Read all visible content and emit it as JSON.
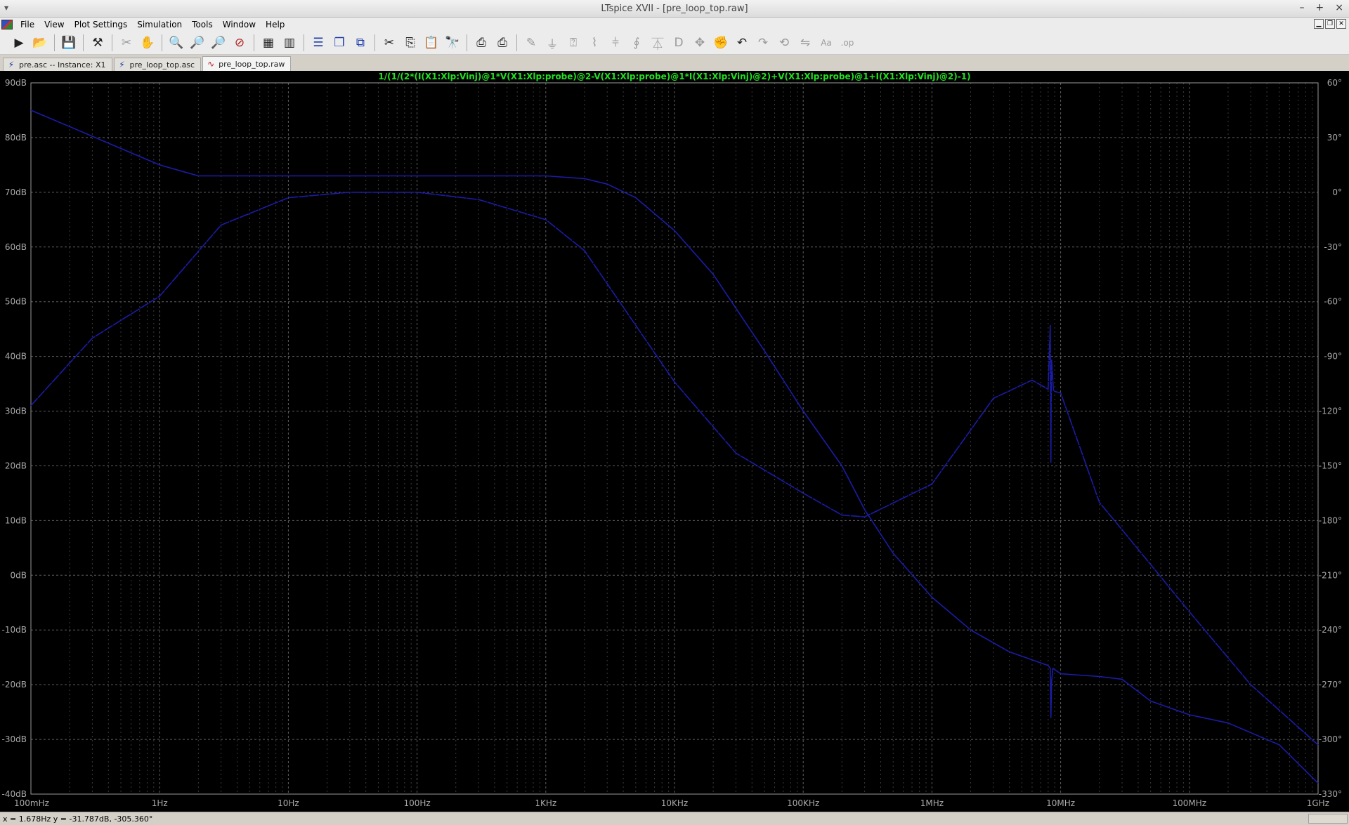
{
  "window": {
    "title": "LTspice XVII - [pre_loop_top.raw]",
    "sysmenu": "▾",
    "controls": [
      "–",
      "+",
      "×"
    ]
  },
  "menu": [
    "File",
    "View",
    "Plot Settings",
    "Simulation",
    "Tools",
    "Window",
    "Help"
  ],
  "mdi_controls": [
    "▁",
    "❐",
    "✕"
  ],
  "toolbar": [
    {
      "icon": "run-icon",
      "glyph": "▶"
    },
    {
      "icon": "open-icon",
      "glyph": "📂"
    },
    {
      "sep": true
    },
    {
      "icon": "save-icon",
      "glyph": "💾"
    },
    {
      "sep": true
    },
    {
      "icon": "control-panel-icon",
      "glyph": "⚒"
    },
    {
      "sep": true
    },
    {
      "icon": "halt-icon",
      "glyph": "✂",
      "dim": true
    },
    {
      "icon": "pan-icon",
      "glyph": "✋",
      "dim": true
    },
    {
      "sep": true
    },
    {
      "icon": "zoom-in-icon",
      "glyph": "🔍"
    },
    {
      "icon": "zoom-out-icon",
      "glyph": "🔎"
    },
    {
      "icon": "zoom-back-icon",
      "glyph": "🔎"
    },
    {
      "icon": "zoom-fit-icon",
      "glyph": "⊘",
      "red": true
    },
    {
      "sep": true
    },
    {
      "icon": "autorange-icon",
      "glyph": "▦"
    },
    {
      "icon": "plot-settings-icon",
      "glyph": "▥"
    },
    {
      "sep": true
    },
    {
      "icon": "tile-horizontal-icon",
      "glyph": "☰",
      "blue": true
    },
    {
      "icon": "cascade-icon",
      "glyph": "❐",
      "blue": true
    },
    {
      "icon": "tile-vertical-icon",
      "glyph": "⧉",
      "blue": true
    },
    {
      "sep": true
    },
    {
      "icon": "cut-icon",
      "glyph": "✂"
    },
    {
      "icon": "copy-icon",
      "glyph": "⎘"
    },
    {
      "icon": "paste-icon",
      "glyph": "📋"
    },
    {
      "icon": "find-icon",
      "glyph": "🔭"
    },
    {
      "sep": true
    },
    {
      "icon": "print-icon",
      "glyph": "⎙"
    },
    {
      "icon": "print-setup-icon",
      "glyph": "⎙"
    },
    {
      "sep": true
    },
    {
      "icon": "wire-icon",
      "glyph": "✎",
      "dim": true
    },
    {
      "icon": "ground-icon",
      "glyph": "⏚",
      "dim": true
    },
    {
      "icon": "label-icon",
      "glyph": "⍰",
      "dim": true
    },
    {
      "icon": "resistor-icon",
      "glyph": "⌇",
      "dim": true
    },
    {
      "icon": "capacitor-icon",
      "glyph": "⫩",
      "dim": true
    },
    {
      "icon": "inductor-icon",
      "glyph": "∮",
      "dim": true
    },
    {
      "icon": "diode-icon",
      "glyph": "⏄",
      "dim": true
    },
    {
      "icon": "component-icon",
      "glyph": "D",
      "dim": true
    },
    {
      "icon": "move-icon",
      "glyph": "✥",
      "dim": true
    },
    {
      "icon": "drag-icon",
      "glyph": "✊",
      "dim": true
    },
    {
      "icon": "undo-icon",
      "glyph": "↶"
    },
    {
      "icon": "redo-icon",
      "glyph": "↷",
      "dim": true
    },
    {
      "icon": "rotate-icon",
      "glyph": "⟲",
      "dim": true
    },
    {
      "icon": "mirror-icon",
      "glyph": "⇋",
      "dim": true
    },
    {
      "icon": "text-icon",
      "glyph": "Aa",
      "dim": true
    },
    {
      "icon": "spice-directive-icon",
      "glyph": ".op",
      "dim": true
    }
  ],
  "tabs": [
    {
      "label": "pre.asc -- Instance: X1",
      "kind": "sch",
      "active": false
    },
    {
      "label": "pre_loop_top.asc",
      "kind": "sch",
      "active": false
    },
    {
      "label": "pre_loop_top.raw",
      "kind": "wav",
      "active": true
    }
  ],
  "status": "x = 1.678Hz    y = -31.787dB, -305.360°",
  "chart_data": {
    "type": "line",
    "title": "1/(1/(2*(I(X1:Xlp:Vinj)@1*V(X1:Xlp:probe)@2-V(X1:Xlp:probe)@1*I(X1:Xlp:Vinj)@2)+V(X1:Xlp:probe)@1+I(X1:Xlp:Vinj)@2)-1)",
    "x_scale": "log",
    "x_ticks": [
      "100mHz",
      "1Hz",
      "10Hz",
      "100Hz",
      "1KHz",
      "10KHz",
      "100KHz",
      "1MHz",
      "10MHz",
      "100MHz",
      "1GHz"
    ],
    "xlim": [
      0.1,
      1000000000
    ],
    "y_left_ticks": [
      "90dB",
      "80dB",
      "70dB",
      "60dB",
      "50dB",
      "40dB",
      "30dB",
      "20dB",
      "10dB",
      "0dB",
      "-10dB",
      "-20dB",
      "-30dB",
      "-40dB"
    ],
    "ylim_left": [
      -40,
      90
    ],
    "y_right_ticks": [
      "60°",
      "30°",
      "0°",
      "-30°",
      "-60°",
      "-90°",
      "-120°",
      "-150°",
      "-180°",
      "-210°",
      "-240°",
      "-270°",
      "-300°",
      "-330°"
    ],
    "ylim_right": [
      -330,
      60
    ],
    "grid": true,
    "colors": {
      "title": "#22e022",
      "axis_text": "#a8a8a8",
      "grid": "#6a6a6a",
      "trace": "#1c1ca8"
    },
    "series": [
      {
        "axis": "left",
        "x": [
          0.1,
          0.2,
          0.5,
          1,
          2,
          4,
          10,
          100,
          1000,
          2000,
          3000,
          5000,
          10000,
          20000,
          50000,
          100000,
          200000,
          300000,
          500000,
          1000000,
          2000000,
          4000000,
          8000000,
          8300000,
          8400000,
          8500000,
          8700000,
          10000000,
          20000000,
          30000000,
          50000000,
          100000000,
          200000000,
          500000000,
          1000000000
        ],
        "y": [
          85,
          82,
          78,
          75,
          73,
          73,
          73,
          73,
          73,
          72.5,
          71.5,
          69,
          63,
          55,
          41,
          30,
          20,
          12,
          4,
          -4,
          -10,
          -14,
          -16.5,
          -17,
          -26,
          -19.5,
          -17,
          -18,
          -18.5,
          -19,
          -23,
          -25.5,
          -27,
          -31,
          -38
        ]
      },
      {
        "axis": "right",
        "x": [
          0.1,
          0.3,
          1,
          3,
          10,
          30,
          100,
          300,
          1000,
          2000,
          5000,
          10000,
          30000,
          100000,
          200000,
          300000,
          1000000,
          3000000,
          6000000,
          8000000,
          8300000,
          8350000,
          8400000,
          8450000,
          8500000,
          8800000,
          10000000,
          20000000,
          30000000,
          100000000,
          300000000,
          1000000000
        ],
        "y": [
          -117,
          -80,
          -57,
          -18,
          -3,
          0,
          0,
          -4,
          -15,
          -32,
          -73,
          -104,
          -143,
          -165,
          -177,
          -178,
          -160,
          -113,
          -103,
          -108,
          -73,
          -110,
          -148,
          -110,
          -92,
          -109,
          -110,
          -170,
          -185,
          -230,
          -270,
          -303
        ]
      }
    ]
  }
}
